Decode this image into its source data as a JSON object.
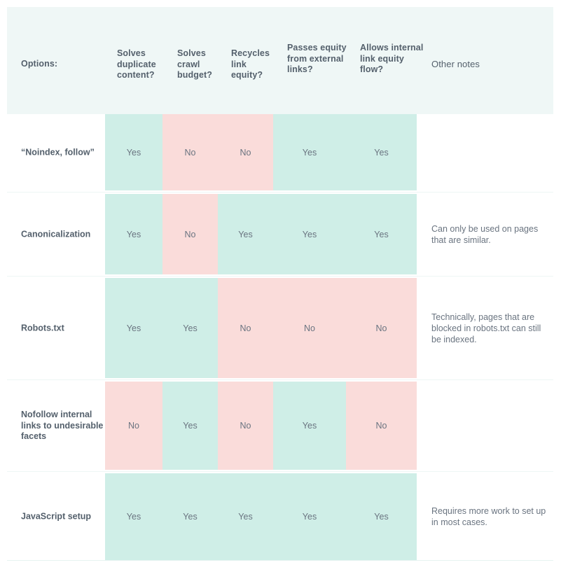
{
  "table": {
    "columns": [
      {
        "key": "option",
        "label": "Options:"
      },
      {
        "key": "c1",
        "label": "Solves duplicate content?"
      },
      {
        "key": "c2",
        "label": "Solves crawl budget?"
      },
      {
        "key": "c3",
        "label": "Recycles link equity?"
      },
      {
        "key": "c4",
        "label": "Passes equity from external links?"
      },
      {
        "key": "c5",
        "label": "Allows internal link equity flow?"
      },
      {
        "key": "notes",
        "label": "Other notes"
      }
    ],
    "rows": [
      {
        "option": "“Noindex, follow”",
        "values": [
          "Yes",
          "No",
          "No",
          "Yes",
          "Yes"
        ],
        "notes": ""
      },
      {
        "option": "Canonicalization",
        "values": [
          "Yes",
          "No",
          "Yes",
          "Yes",
          "Yes"
        ],
        "notes": "Can only be used on pages that are similar."
      },
      {
        "option": "Robots.txt",
        "values": [
          "Yes",
          "Yes",
          "No",
          "No",
          "No"
        ],
        "notes": "Technically, pages that are blocked in robots.txt can still be indexed."
      },
      {
        "option": "Nofollow internal links to undesirable facets",
        "values": [
          "No",
          "Yes",
          "No",
          "Yes",
          "No"
        ],
        "notes": ""
      },
      {
        "option": "JavaScript setup",
        "values": [
          "Yes",
          "Yes",
          "Yes",
          "Yes",
          "Yes"
        ],
        "notes": "Requires more work to set up in most cases."
      }
    ],
    "colors": {
      "header_background": "#eff7f6",
      "yes_background": "#cfeee7",
      "no_background": "#fadcda",
      "text": "#54606c",
      "value_text": "#6a7480",
      "separator": "#eef6f5",
      "page_background": "#ffffff"
    }
  }
}
